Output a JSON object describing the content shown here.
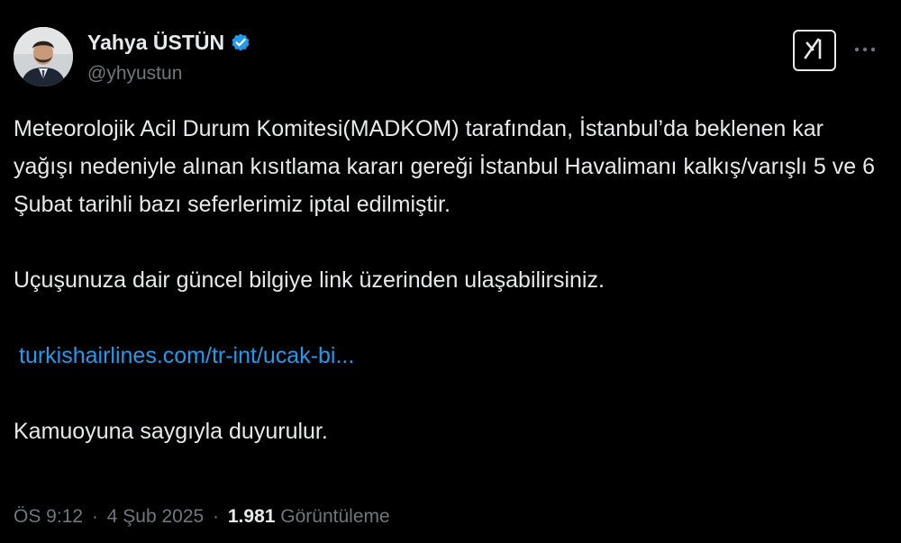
{
  "author": {
    "display_name": "Yahya ÜSTÜN",
    "handle": "@yhyustun",
    "verified": true,
    "verified_color": "#1d9bf0"
  },
  "icons": {
    "verified": "verified-badge-icon",
    "grok": "grok-icon",
    "more": "more-horizontal-icon"
  },
  "tweet": {
    "paragraph_1": "Meteorolojik Acil Durum Komitesi(MADKOM) tarafından, İstanbul’da beklenen kar yağışı nedeniyle alınan kısıtlama kararı gereği İstanbul Havalimanı kalkış/varışlı 5 ve 6 Şubat tarihli bazı seferlerimiz iptal edilmiştir.",
    "paragraph_2": "Uçuşunuza dair güncel bilgiye link üzerinden ulaşabilirsiniz.",
    "link_text": "turkishairlines.com/tr-int/ucak-bi...",
    "paragraph_3": "Kamuoyuna saygıyla duyurulur."
  },
  "meta": {
    "time": "ÖS 9:12",
    "separator": "·",
    "date": "4 Şub 2025",
    "views_count": "1.981",
    "views_label": "Görüntüleme"
  },
  "colors": {
    "background": "#000000",
    "text": "#e7e9ea",
    "secondary": "#71767b",
    "link": "#1d9bf0"
  }
}
